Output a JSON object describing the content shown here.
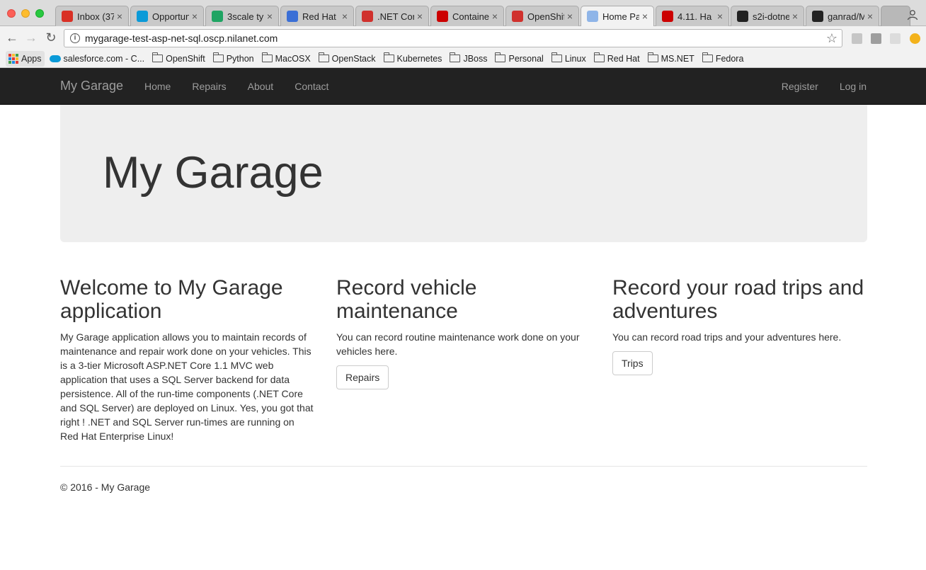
{
  "browser": {
    "tabs": [
      {
        "title": "Inbox (37",
        "icon": "gmail-icon",
        "color": "#d93025"
      },
      {
        "title": "Opportun",
        "icon": "salesforce-icon",
        "color": "#0a9ad8"
      },
      {
        "title": "3scale ty",
        "icon": "google-drive-icon",
        "color": "#1fa463"
      },
      {
        "title": "Red Hat",
        "icon": "calendar-icon",
        "color": "#3b6fd6"
      },
      {
        "title": ".NET Cor",
        "icon": "openshift-icon",
        "color": "#d0312d"
      },
      {
        "title": "Containe",
        "icon": "redhat-icon",
        "color": "#cc0000"
      },
      {
        "title": "OpenShif",
        "icon": "openshift-icon",
        "color": "#d0312d"
      },
      {
        "title": "Home Pa",
        "icon": "page-icon",
        "color": "#8fb5e8",
        "active": true
      },
      {
        "title": "4.11. Ha",
        "icon": "redhat-icon",
        "color": "#cc0000"
      },
      {
        "title": "s2i-dotne",
        "icon": "github-icon",
        "color": "#222222"
      },
      {
        "title": "ganrad/M",
        "icon": "github-icon",
        "color": "#222222"
      }
    ],
    "close_glyph": "×",
    "url": "mygarage-test-asp-net-sql.oscp.nilanet.com",
    "bookmarks": [
      {
        "label": "Apps",
        "type": "apps"
      },
      {
        "label": "salesforce.com - C...",
        "type": "salesforce"
      },
      {
        "label": "OpenShift",
        "type": "folder"
      },
      {
        "label": "Python",
        "type": "folder"
      },
      {
        "label": "MacOSX",
        "type": "folder"
      },
      {
        "label": "OpenStack",
        "type": "folder"
      },
      {
        "label": "Kubernetes",
        "type": "folder"
      },
      {
        "label": "JBoss",
        "type": "folder"
      },
      {
        "label": "Personal",
        "type": "folder"
      },
      {
        "label": "Linux",
        "type": "folder"
      },
      {
        "label": "Red Hat",
        "type": "folder"
      },
      {
        "label": "MS.NET",
        "type": "folder"
      },
      {
        "label": "Fedora",
        "type": "folder"
      }
    ]
  },
  "nav": {
    "brand": "My Garage",
    "links": [
      "Home",
      "Repairs",
      "About",
      "Contact"
    ],
    "right": [
      "Register",
      "Log in"
    ]
  },
  "jumbotron": {
    "title": "My Garage"
  },
  "columns": [
    {
      "heading": "Welcome to My Garage application",
      "body": "My Garage application allows you to maintain records of maintenance and repair work done on your vehicles. This is a 3-tier Microsoft ASP.NET Core 1.1 MVC web application that uses a SQL Server backend for data persistence. All of the run-time components (.NET Core and SQL Server) are deployed on Linux. Yes, you got that right ! .NET and SQL Server run-times are running on Red Hat Enterprise Linux!"
    },
    {
      "heading": "Record vehicle maintenance",
      "body": "You can record routine maintenance work done on your vehicles here.",
      "button": "Repairs"
    },
    {
      "heading": "Record your road trips and adventures",
      "body": "You can record road trips and your adventures here.",
      "button": "Trips"
    }
  ],
  "footer": {
    "text": "© 2016 - My Garage"
  }
}
